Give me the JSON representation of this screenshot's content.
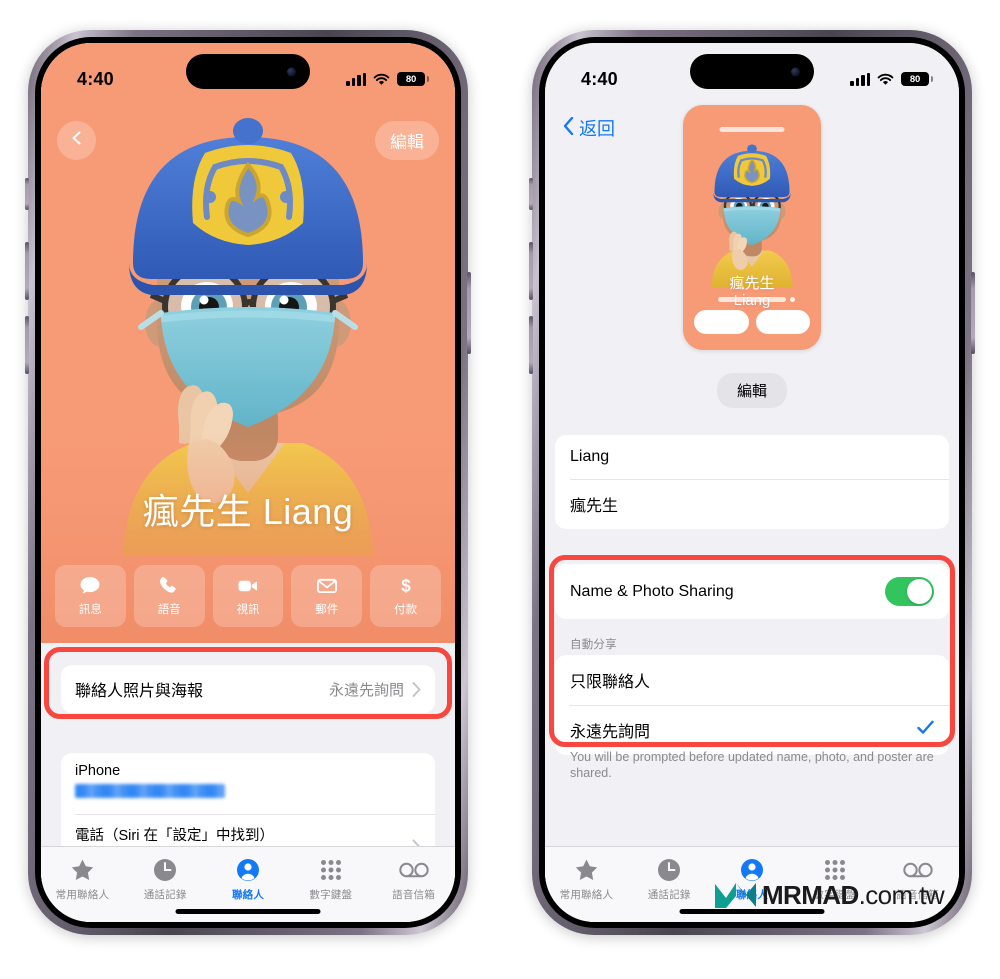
{
  "statusbar": {
    "time": "4:40",
    "battery": "80",
    "signal_icon": "cellular-bars-icon",
    "wifi_icon": "wifi-icon",
    "battery_icon": "battery-icon"
  },
  "colors": {
    "poster_bg": "#f79a76",
    "accent_blue": "#1479f5",
    "toggle_green": "#32c55e",
    "highlight_red": "#f8473f",
    "list_bg": "#f1f1f5"
  },
  "left_phone": {
    "nav": {
      "back_icon": "chevron-left-icon",
      "edit_label": "編輯"
    },
    "contact_name": "瘋先生 Liang",
    "actions": [
      {
        "icon": "message-icon",
        "label": "訊息"
      },
      {
        "icon": "phone-icon",
        "label": "語音"
      },
      {
        "icon": "video-icon",
        "label": "視訊"
      },
      {
        "icon": "mail-icon",
        "label": "郵件"
      },
      {
        "icon": "dollar-icon",
        "label": "付款"
      }
    ],
    "poster_row": {
      "label": "聯絡人照片與海報",
      "value": "永遠先詢問",
      "chevron_icon": "chevron-right-icon"
    },
    "phone_group": [
      {
        "title": "iPhone",
        "value_masked": true
      },
      {
        "title": "電話（Siri 在「設定」中找到）",
        "value_masked": true,
        "chevron_icon": "chevron-right-icon"
      }
    ]
  },
  "right_phone": {
    "nav": {
      "back_icon": "chevron-left-icon",
      "back_label": "返回"
    },
    "poster_card": {
      "name_line1": "瘋先生",
      "name_line2": "Liang"
    },
    "edit_chip": "編輯",
    "name_fields": [
      {
        "value": "Liang"
      },
      {
        "value": "瘋先生"
      }
    ],
    "sharing": {
      "toggle_label": "Name & Photo Sharing",
      "toggle_on": true,
      "section_header": "自動分享",
      "options": [
        {
          "label": "只限聯絡人",
          "selected": false
        },
        {
          "label": "永遠先詢問",
          "selected": true,
          "check_icon": "checkmark-icon"
        }
      ],
      "footnote": "You will be prompted before updated name, photo, and poster are shared."
    }
  },
  "tabbar": {
    "items": [
      {
        "icon": "star-icon",
        "label": "常用聯絡人",
        "active": false
      },
      {
        "icon": "clock-icon",
        "label": "通話記錄",
        "active": false
      },
      {
        "icon": "person-icon",
        "label": "聯絡人",
        "active": true
      },
      {
        "icon": "keypad-icon",
        "label": "數字鍵盤",
        "active": false
      },
      {
        "icon": "voicemail-icon",
        "label": "語音信箱",
        "active": false
      }
    ]
  },
  "watermark": {
    "brand": "MRMAD",
    "suffix": ".com.tw",
    "logo_icon": "mrmad-logo-icon"
  }
}
